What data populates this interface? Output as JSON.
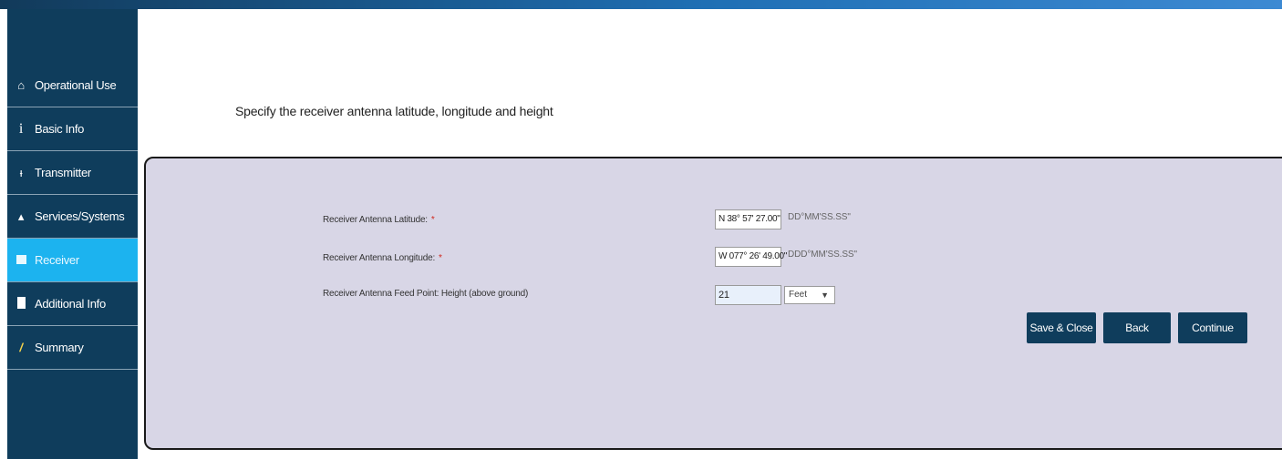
{
  "nav": {
    "items": [
      {
        "label": "Operational Use",
        "icon": "home-icon"
      },
      {
        "label": "Basic Info",
        "icon": "info-icon"
      },
      {
        "label": "Transmitter",
        "icon": "antenna-icon"
      },
      {
        "label": "Services/Systems",
        "icon": "satellite-icon"
      },
      {
        "label": "Receiver",
        "icon": "receiver-icon",
        "active": true
      },
      {
        "label": "Additional Info",
        "icon": "document-icon"
      },
      {
        "label": "Summary",
        "icon": "pencil-icon"
      }
    ]
  },
  "instruction": "Specify the receiver antenna latitude, longitude and height",
  "form": {
    "required_marker": "*",
    "latitude": {
      "label": "Receiver Antenna Latitude:",
      "value": "N 38° 57' 27.00\"",
      "format": "DD°MM'SS.SS\""
    },
    "longitude": {
      "label": "Receiver Antenna Longitude:",
      "value": "W 077° 26' 49.00\"",
      "format": "DDD°MM'SS.SS\""
    },
    "height": {
      "label": "Receiver Antenna Feed Point: Height (above ground)",
      "value": "21",
      "unit": "Feet",
      "dropdown_icon": "▼"
    }
  },
  "buttons": {
    "save_close": "Save & Close",
    "back": "Back",
    "continue": "Continue"
  },
  "colors": {
    "sidebar": "#0f3d5c",
    "active_item": "#1cb3ef",
    "panel": "#d8d6e6",
    "button": "#0f3d5c",
    "required": "#d0281e"
  }
}
